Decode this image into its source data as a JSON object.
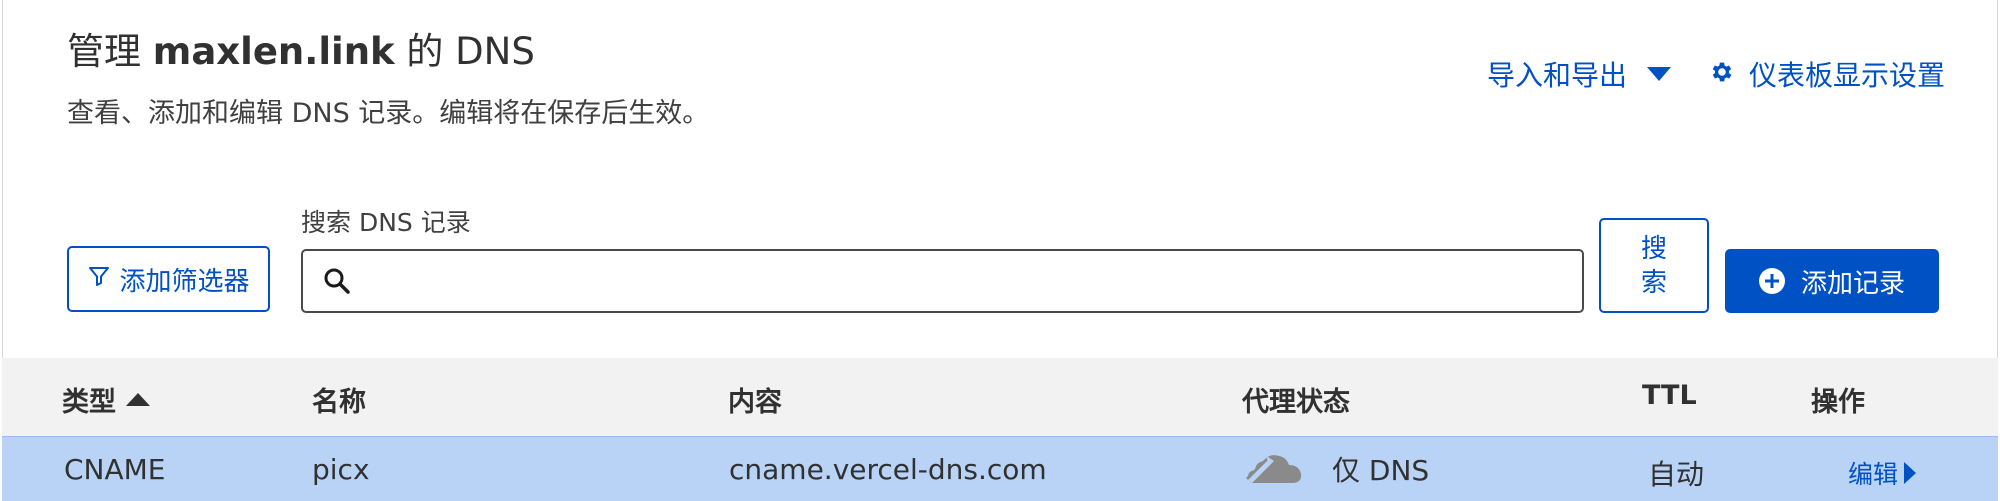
{
  "header": {
    "title_prefix": "管理",
    "domain": "maxlen.link",
    "title_suffix": "的 DNS",
    "subtitle": "查看、添加和编辑 DNS 记录。编辑将在保存后生效。",
    "import_export_label": "导入和导出",
    "dashboard_settings_label": "仪表板显示设置"
  },
  "toolbar": {
    "search_label": "搜索 DNS 记录",
    "search_value": "",
    "search_placeholder": "",
    "filter_label": "添加筛选器",
    "search_button_line1": "搜",
    "search_button_line2": "索",
    "add_record_label": "添加记录"
  },
  "table": {
    "columns": {
      "type": "类型",
      "name": "名称",
      "content": "内容",
      "proxy": "代理状态",
      "ttl": "TTL",
      "actions": "操作"
    },
    "rows": [
      {
        "type": "CNAME",
        "name": "picx",
        "content": "cname.vercel-dns.com",
        "proxy": "仅 DNS",
        "ttl": "自动",
        "action": "编辑"
      }
    ]
  },
  "colors": {
    "accent": "#0051c3",
    "selected_row": "#b8d3f6",
    "header_bg": "#f2f2f2"
  },
  "icons": {
    "import_export": "chevron-down-icon",
    "settings": "gear-icon",
    "filter": "filter-icon",
    "search": "search-icon",
    "add": "plus-circle-icon",
    "sort": "sort-up-icon",
    "proxy": "dns-only-cloud-icon",
    "edit": "chevron-right-icon"
  }
}
